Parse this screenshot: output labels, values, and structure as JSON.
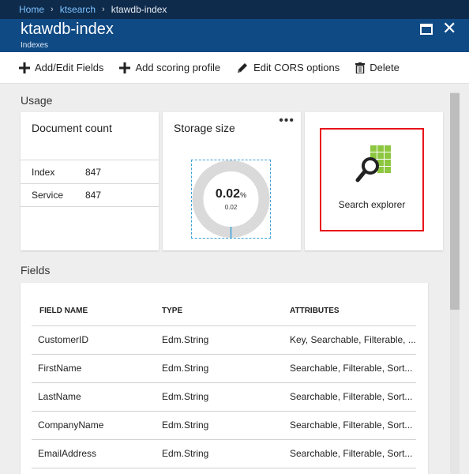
{
  "breadcrumb": {
    "items": [
      "Home",
      "ktsearch"
    ],
    "current": "ktawdb-index"
  },
  "header": {
    "title": "ktawdb-index",
    "subtitle": "Indexes"
  },
  "toolbar": {
    "add_edit_fields": "Add/Edit Fields",
    "add_scoring_profile": "Add scoring profile",
    "edit_cors": "Edit CORS options",
    "delete": "Delete"
  },
  "usage": {
    "label": "Usage",
    "document_count": {
      "title": "Document count",
      "rows": [
        {
          "label": "Index",
          "value": "847"
        },
        {
          "label": "Service",
          "value": "847"
        }
      ]
    },
    "storage": {
      "title": "Storage size",
      "percent": "0.02",
      "percent_unit": "%",
      "value": "0.02",
      "fraction": 0.0002
    },
    "search_explorer": {
      "label": "Search explorer"
    }
  },
  "fields": {
    "label": "Fields",
    "columns": [
      "FIELD NAME",
      "TYPE",
      "ATTRIBUTES"
    ],
    "rows": [
      {
        "name": "CustomerID",
        "type": "Edm.String",
        "attributes": "Key, Searchable, Filterable, ..."
      },
      {
        "name": "FirstName",
        "type": "Edm.String",
        "attributes": "Searchable, Filterable, Sort..."
      },
      {
        "name": "LastName",
        "type": "Edm.String",
        "attributes": "Searchable, Filterable, Sort..."
      },
      {
        "name": "CompanyName",
        "type": "Edm.String",
        "attributes": "Searchable, Filterable, Sort..."
      },
      {
        "name": "EmailAddress",
        "type": "Edm.String",
        "attributes": "Searchable, Filterable, Sort..."
      }
    ]
  },
  "colors": {
    "accent_link": "#7cc3ff",
    "header_bg": "#0f4a85",
    "highlight": "#e8141b",
    "search_grid": "#8dc63f"
  }
}
